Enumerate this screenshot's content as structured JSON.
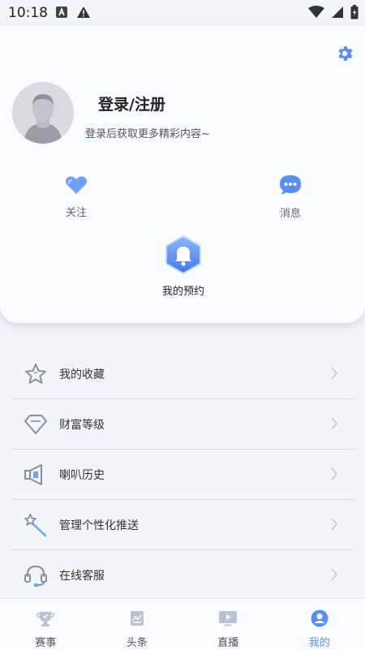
{
  "status_bar": {
    "time": "10:18",
    "left_icons": [
      "a-notification-icon",
      "warning-icon"
    ],
    "right_icons": [
      "wifi-icon",
      "signal-icon",
      "battery-icon"
    ]
  },
  "profile": {
    "title": "登录/注册",
    "subtitle": "登录后获取更多精彩内容~"
  },
  "quick_actions": {
    "follow": "关注",
    "messages": "消息",
    "appointment": "我的预约"
  },
  "menu": [
    {
      "label": "我的收藏",
      "icon": "star-icon"
    },
    {
      "label": "财富等级",
      "icon": "diamond-icon"
    },
    {
      "label": "喇叭历史",
      "icon": "megaphone-icon"
    },
    {
      "label": "管理个性化推送",
      "icon": "magic-wand-icon"
    },
    {
      "label": "在线客服",
      "icon": "headset-icon"
    }
  ],
  "tabs": [
    {
      "label": "赛事",
      "icon": "trophy-icon",
      "active": false
    },
    {
      "label": "头条",
      "icon": "news-icon",
      "active": false
    },
    {
      "label": "直播",
      "icon": "play-icon",
      "active": false
    },
    {
      "label": "我的",
      "icon": "profile-icon",
      "active": true
    }
  ],
  "colors": {
    "accent": "#5a8ef0",
    "icon_gray": "#8a8f99",
    "background": "#f2f5fa"
  }
}
